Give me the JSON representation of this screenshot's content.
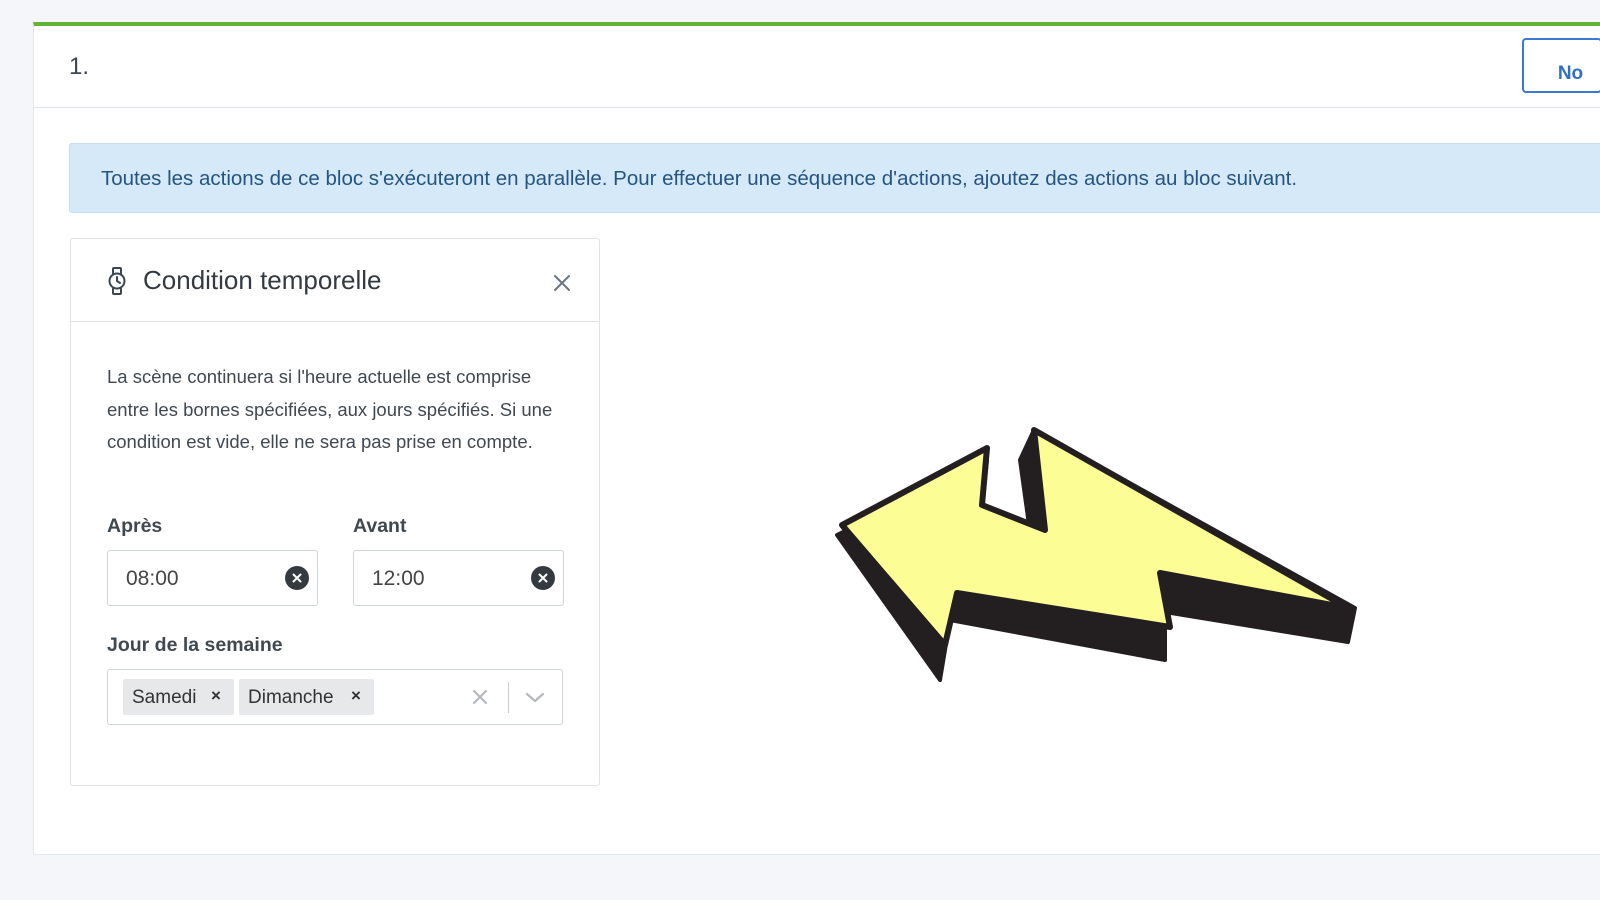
{
  "block": {
    "number": "1.",
    "header_button_label": "No",
    "accent_color": "#63b339"
  },
  "info_alert": {
    "text": "Toutes les actions de ce bloc s'exécuteront en parallèle. Pour effectuer une séquence d'actions, ajoutez des actions au bloc suivant."
  },
  "card": {
    "icon": "watch-icon",
    "title": "Condition temporelle",
    "description": "La scène continuera si l'heure actuelle est comprise entre les bornes spécifiées, aux jours spécifiés. Si une condition est vide, elle ne sera pas prise en compte.",
    "after": {
      "label": "Après",
      "value": "08:00"
    },
    "before": {
      "label": "Avant",
      "value": "12:00"
    },
    "weekday": {
      "label": "Jour de la semaine",
      "selected": [
        "Samedi",
        "Dimanche"
      ],
      "remove_glyph": "×"
    }
  },
  "decoration": {
    "icon": "yellow-arrow-icon",
    "fill_color": "#fdfd96",
    "stroke_color": "#231f20"
  }
}
